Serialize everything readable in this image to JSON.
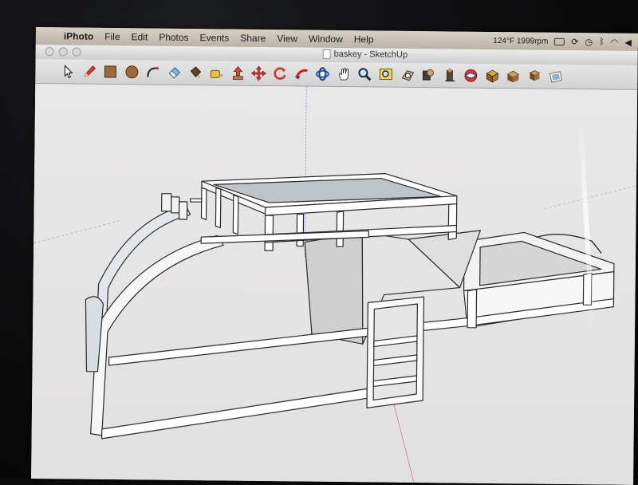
{
  "menubar": {
    "app_name": "iPhoto",
    "items": [
      "File",
      "Edit",
      "Photos",
      "Events",
      "Share",
      "View",
      "Window",
      "Help"
    ],
    "status_text": "124°F 1999rpm"
  },
  "window": {
    "title": "baskey - SketchUp"
  },
  "toolbar": {
    "tools": [
      "select-arrow-icon",
      "pencil-icon",
      "rectangle-icon",
      "circle-icon",
      "arc-icon",
      "eraser-icon",
      "paint-bucket-icon",
      "tape-measure-icon",
      "push-pull-icon",
      "move-icon",
      "rotate-icon",
      "follow-me-icon",
      "orbit-icon",
      "pan-hand-icon",
      "zoom-icon",
      "zoom-window-icon",
      "zoom-extents-icon",
      "previous-view-icon",
      "position-camera-icon",
      "walk-icon",
      "get-models-icon",
      "share-model-icon",
      "components-icon",
      "materials-icon",
      "styles-icon"
    ]
  },
  "colors": {
    "canvas": "#e6e5e5",
    "model_face": "#ffffff",
    "model_shade": "#c9c9c9",
    "axis_blue": "#7d7dd6",
    "axis_red": "#d77a7a",
    "axis_green": "#74b474"
  }
}
